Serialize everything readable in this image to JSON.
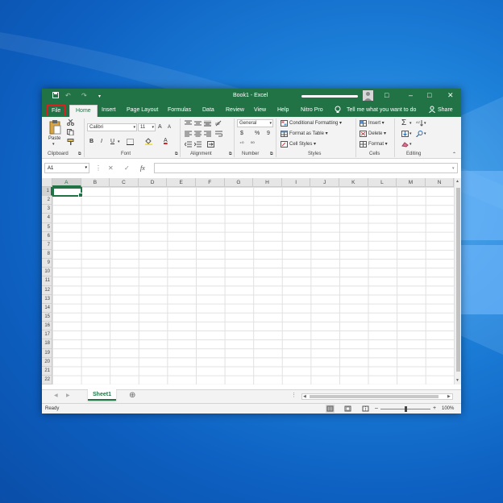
{
  "window": {
    "title": "Book1  -  Excel",
    "controls": {
      "ribbon_display": "□",
      "minimize": "–",
      "maximize": "□",
      "close": "✕"
    },
    "quick_access": {
      "save": "💾",
      "undo": "↶",
      "redo": "↷",
      "customize": "▾"
    }
  },
  "tabs": [
    {
      "label": "File"
    },
    {
      "label": "Home"
    },
    {
      "label": "Insert"
    },
    {
      "label": "Page Layout"
    },
    {
      "label": "Formulas"
    },
    {
      "label": "Data"
    },
    {
      "label": "Review"
    },
    {
      "label": "View"
    },
    {
      "label": "Help"
    },
    {
      "label": "Nitro Pro"
    }
  ],
  "tell_me": "Tell me what you want to do",
  "share": "Share",
  "ribbon": {
    "clipboard": {
      "paste": "Paste",
      "label": "Clipboard"
    },
    "font": {
      "name": "Calibri",
      "size": "11",
      "grow": "A",
      "shrink": "A",
      "bold": "B",
      "italic": "I",
      "underline": "U",
      "font_color": "A",
      "label": "Font"
    },
    "alignment": {
      "label": "Alignment"
    },
    "number": {
      "format": "General",
      "currency": "$",
      "percent": "%",
      "comma": "9",
      "inc_decimal": "⁺⁰",
      "dec_decimal": "⁰⁰",
      "label": "Number"
    },
    "styles": {
      "conditional": "Conditional Formatting",
      "format_table": "Format as Table",
      "cell_styles": "Cell Styles",
      "label": "Styles"
    },
    "cells": {
      "insert": "Insert",
      "delete": "Delete",
      "format": "Format",
      "label": "Cells"
    },
    "editing": {
      "label": "Editing"
    }
  },
  "formula_bar": {
    "name_box": "A1",
    "cancel": "✕",
    "enter": "✓",
    "fx": "fx",
    "value": ""
  },
  "grid": {
    "columns": [
      "A",
      "B",
      "C",
      "D",
      "E",
      "F",
      "G",
      "H",
      "I",
      "J",
      "K",
      "L",
      "M",
      "N"
    ],
    "rows": [
      "1",
      "2",
      "3",
      "4",
      "5",
      "6",
      "7",
      "8",
      "9",
      "10",
      "11",
      "12",
      "13",
      "14",
      "15",
      "16",
      "17",
      "18",
      "19",
      "20",
      "21",
      "22"
    ],
    "active_cell": "A1"
  },
  "sheets": [
    {
      "name": "Sheet1"
    }
  ],
  "add_sheet": "⊕",
  "status": {
    "text": "Ready",
    "zoom": "100%",
    "zoom_minus": "–",
    "zoom_plus": "+"
  },
  "colors": {
    "excel_green": "#217346",
    "file_highlight": "#e02020",
    "desktop_blue": "#1c7fd8"
  }
}
